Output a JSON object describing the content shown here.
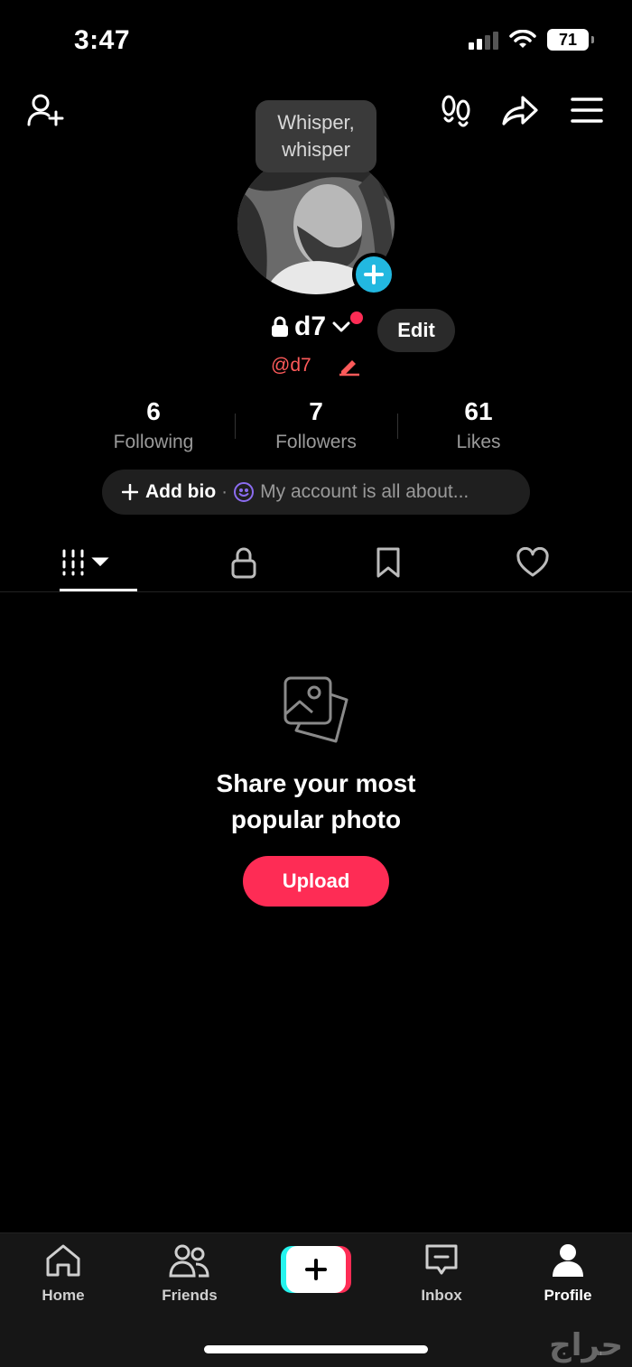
{
  "status_bar": {
    "time": "3:47",
    "battery": "71"
  },
  "profile": {
    "tooltip": "Whisper, whisper",
    "username": "d7",
    "handle": "@d7",
    "edit_label": "Edit"
  },
  "stats": [
    {
      "value": "6",
      "label": "Following"
    },
    {
      "value": "7",
      "label": "Followers"
    },
    {
      "value": "61",
      "label": "Likes"
    }
  ],
  "bio": {
    "add_label": "Add bio",
    "hint": "My account is all about..."
  },
  "empty_state": {
    "title": "Share your most popular photo",
    "button": "Upload"
  },
  "bottom_nav": [
    {
      "label": "Home",
      "icon": "home-icon"
    },
    {
      "label": "Friends",
      "icon": "friends-icon"
    },
    {
      "label": "",
      "icon": "create-plus-icon"
    },
    {
      "label": "Inbox",
      "icon": "inbox-icon"
    },
    {
      "label": "Profile",
      "icon": "profile-icon"
    }
  ],
  "watermark": "حراج",
  "colors": {
    "accent": "#fe2c55",
    "avatar_add": "#22b8e0",
    "handle": "#fe5a5a"
  }
}
